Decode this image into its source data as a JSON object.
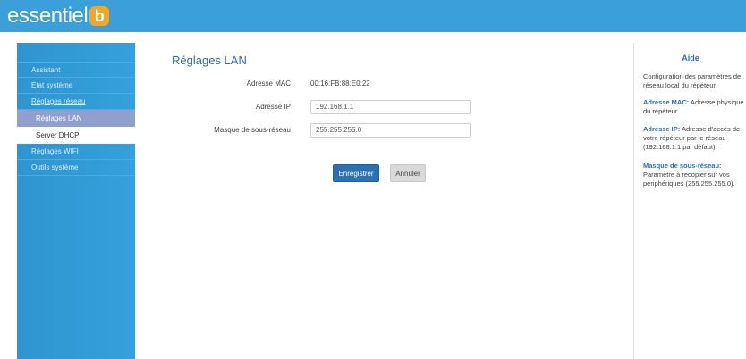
{
  "brand": {
    "name": "essentiel",
    "badge": "b"
  },
  "sidebar": {
    "items": [
      {
        "label": "Assistant"
      },
      {
        "label": "Etat système"
      },
      {
        "label": "Réglages réseau"
      },
      {
        "label": "Réglages LAN"
      },
      {
        "label": "Server DHCP"
      },
      {
        "label": "Réglages WIFI"
      },
      {
        "label": "Outils système"
      }
    ]
  },
  "main": {
    "title": "Réglages LAN",
    "mac_label": "Adresse MAC",
    "mac_value": "00:16:FB:88:E0:22",
    "ip_label": "Adresse IP",
    "ip_value": "192.168.1.1",
    "mask_label": "Masque de sous-réseau",
    "mask_value": "255.255.255.0",
    "save_label": "Enregistrer",
    "cancel_label": "Annuler"
  },
  "help": {
    "title": "Aide",
    "intro": "Configuration des paramètres de réseau local du répéteur",
    "mac_term": "Adresse MAC:",
    "mac_text": " Adresse physique du répéteur.",
    "ip_term": "Adresse IP:",
    "ip_text": " Adresse d'accès de votre répéteur par le réseau (192.168.1.1 par défaut).",
    "mask_term": "Masque de sous-réseau:",
    "mask_text": "Paramètre à recopier sur vos périphériques (255.255.255.0)."
  },
  "colors": {
    "topbar": "#3b9fd9",
    "sidebar": "#34a0dc",
    "accent": "#2c70b3",
    "active_item": "#8f9fce",
    "logo_badge": "#f5a623"
  }
}
